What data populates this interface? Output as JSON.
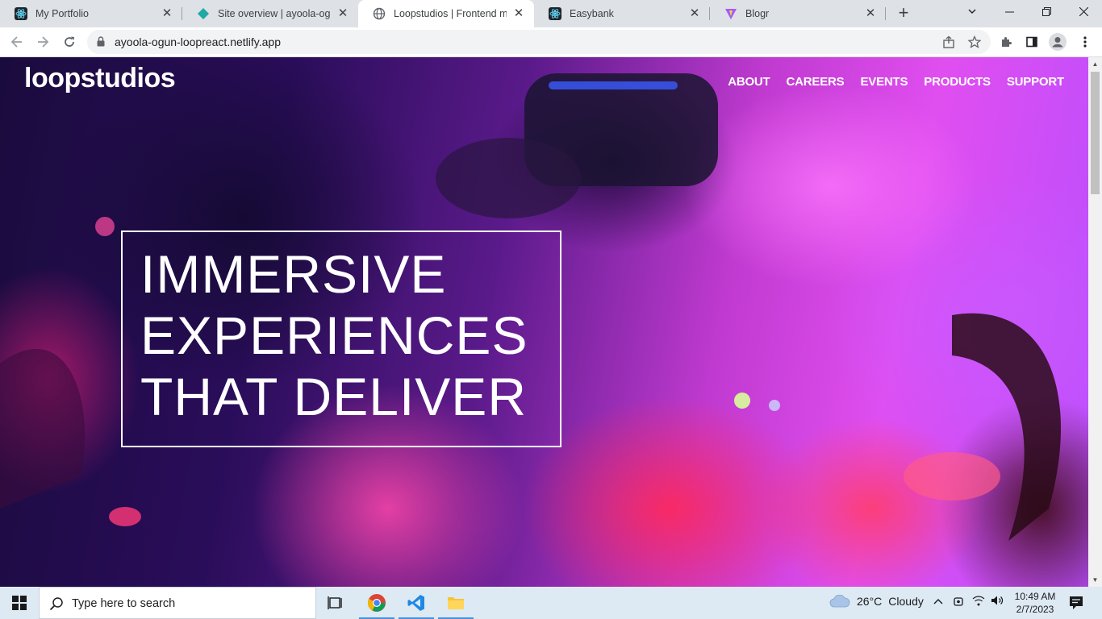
{
  "browser": {
    "tabs": [
      {
        "title": "My Portfolio",
        "icon": "react-icon"
      },
      {
        "title": "Site overview | ayoola-ogun-l",
        "icon": "netlify-icon"
      },
      {
        "title": "Loopstudios | Frontend ment",
        "icon": "globe-icon",
        "active": true
      },
      {
        "title": "Easybank",
        "icon": "react-icon"
      },
      {
        "title": "Blogr",
        "icon": "vite-icon"
      }
    ],
    "url": "ayoola-ogun-loopreact.netlify.app"
  },
  "page": {
    "logo": "loopstudios",
    "nav": [
      "ABOUT",
      "CAREERS",
      "EVENTS",
      "PRODUCTS",
      "SUPPORT"
    ],
    "hero": [
      "IMMERSIVE",
      "EXPERIENCES",
      "THAT DELIVER"
    ]
  },
  "taskbar": {
    "search_placeholder": "Type here to search",
    "weather": {
      "temp": "26°C",
      "condition": "Cloudy"
    },
    "time": "10:49 AM",
    "date": "2/7/2023"
  },
  "colors": {
    "tabstrip": "#dee1e6",
    "taskbar": "#dde9f3",
    "accent": "#4a90d9"
  }
}
